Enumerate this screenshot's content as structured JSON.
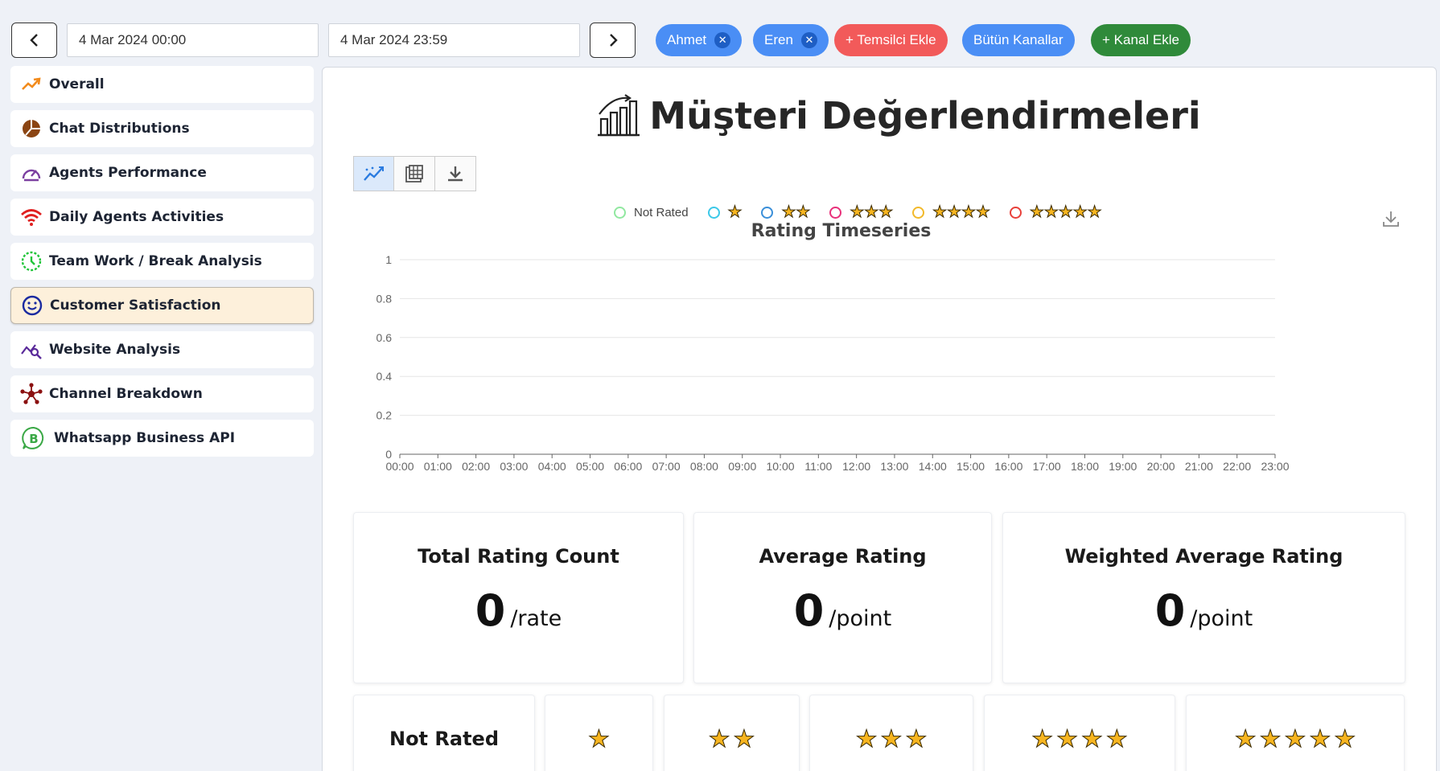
{
  "topbar": {
    "prev_icon": "chevron-left-icon",
    "next_icon": "chevron-right-icon",
    "start_date": "4 Mar 2024 00:00",
    "end_date": "4 Mar 2024 23:59",
    "agents": [
      {
        "label": "Ahmet",
        "remove_icon": "close-icon"
      },
      {
        "label": "Eren",
        "remove_icon": "close-icon"
      }
    ],
    "add_agent_label": "+ Temsilci Ekle",
    "all_channels_label": "Bütün Kanallar",
    "add_channel_label": "+ Kanal Ekle"
  },
  "sidebar": {
    "items": [
      {
        "label": "Overall",
        "icon": "trending-up-icon"
      },
      {
        "label": "Chat Distributions",
        "icon": "pie-chart-icon"
      },
      {
        "label": "Agents Performance",
        "icon": "speedometer-icon"
      },
      {
        "label": "Daily Agents Activities",
        "icon": "wifi-icon"
      },
      {
        "label": "Team Work / Break Analysis",
        "icon": "clock-icon"
      },
      {
        "label": "Customer Satisfaction",
        "icon": "smiley-icon",
        "active": true
      },
      {
        "label": "Website Analysis",
        "icon": "analytics-search-icon"
      },
      {
        "label": "Channel Breakdown",
        "icon": "network-icon"
      },
      {
        "label": "Whatsapp Business API",
        "icon": "whatsapp-business-icon"
      }
    ]
  },
  "main": {
    "title": "Müşteri Değerlendirmeleri",
    "title_icon": "bar-chart-growth-icon",
    "tools": [
      {
        "name": "line-chart-view-icon",
        "active": true
      },
      {
        "name": "table-view-icon",
        "active": false
      },
      {
        "name": "download-icon",
        "active": false
      }
    ],
    "chart_download_icon": "download-icon"
  },
  "colors": {
    "accent_blue": "#4a8ef5",
    "danger_red": "#f25a5a",
    "success_green": "#2f8a3a",
    "active_item_bg": "#fdf0db",
    "star": "#f7b520"
  },
  "chart_data": {
    "type": "line",
    "title": "Rating Timeseries",
    "x": [
      "00:00",
      "01:00",
      "02:00",
      "03:00",
      "04:00",
      "05:00",
      "06:00",
      "07:00",
      "08:00",
      "09:00",
      "10:00",
      "11:00",
      "12:00",
      "13:00",
      "14:00",
      "15:00",
      "16:00",
      "17:00",
      "18:00",
      "19:00",
      "20:00",
      "21:00",
      "22:00",
      "23:00"
    ],
    "ylim": [
      0,
      1
    ],
    "yticks": [
      "0",
      "0.2",
      "0.4",
      "0.6",
      "0.8",
      "1"
    ],
    "grid": true,
    "legend_position": "top-center",
    "series": [
      {
        "name": "Not Rated",
        "stars": 0,
        "color": "#91e8a0",
        "values": []
      },
      {
        "name": "",
        "stars": 1,
        "color": "#3cc8e8",
        "values": []
      },
      {
        "name": "",
        "stars": 2,
        "color": "#3a8fd9",
        "values": []
      },
      {
        "name": "",
        "stars": 3,
        "color": "#e8307a",
        "values": []
      },
      {
        "name": "",
        "stars": 4,
        "color": "#f2b92a",
        "values": []
      },
      {
        "name": "",
        "stars": 5,
        "color": "#e8403a",
        "values": []
      }
    ]
  },
  "stats": [
    {
      "title": "Total Rating Count",
      "value": "0",
      "unit": "/rate"
    },
    {
      "title": "Average Rating",
      "value": "0",
      "unit": "/point"
    },
    {
      "title": "Weighted Average Rating",
      "value": "0",
      "unit": "/point"
    }
  ],
  "rating_cards": [
    {
      "label": "Not Rated",
      "stars": 0
    },
    {
      "label": "",
      "stars": 1
    },
    {
      "label": "",
      "stars": 2
    },
    {
      "label": "",
      "stars": 3
    },
    {
      "label": "",
      "stars": 4
    },
    {
      "label": "",
      "stars": 5
    }
  ],
  "star_glyph": "★"
}
